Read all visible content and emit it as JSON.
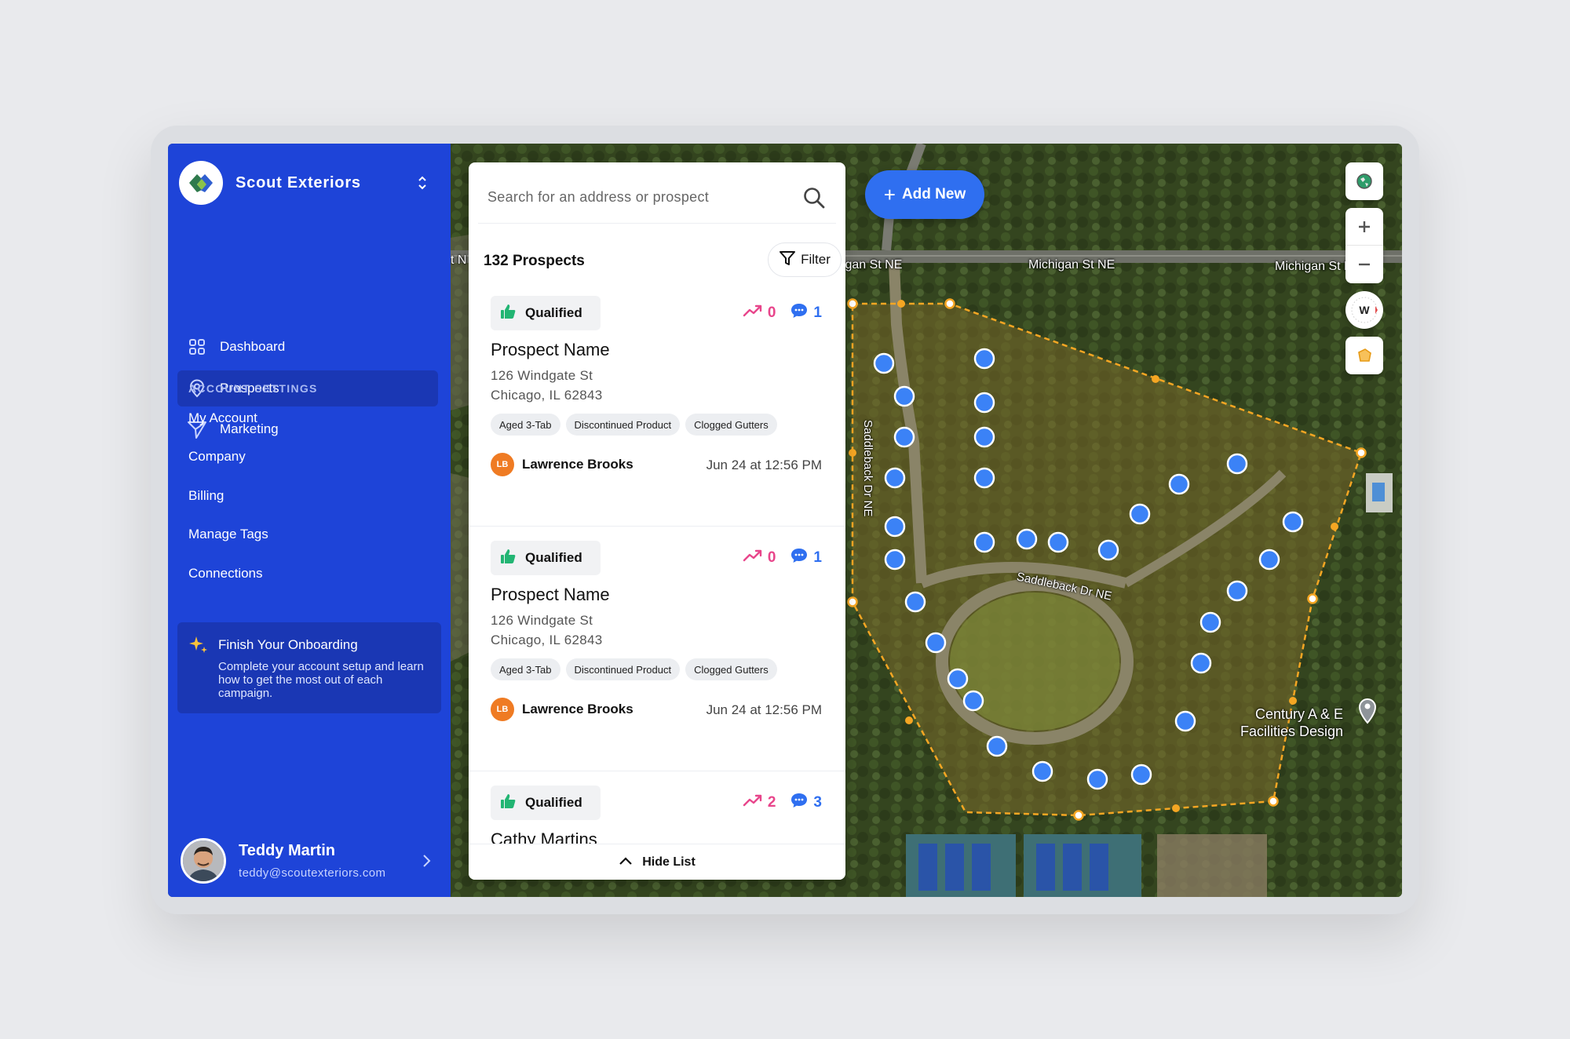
{
  "brand": {
    "name": "Scout Exteriors"
  },
  "nav": {
    "items": [
      {
        "label": "Dashboard",
        "icon": "grid-icon"
      },
      {
        "label": "Prospects",
        "icon": "location-pin-icon",
        "active": true
      },
      {
        "label": "Marketing",
        "icon": "send-icon"
      }
    ]
  },
  "settings": {
    "section_label": "ACCOUNT SETTINGS",
    "links": [
      "My Account",
      "Company",
      "Billing",
      "Manage Tags",
      "Connections"
    ]
  },
  "onboarding": {
    "title": "Finish Your Onboarding",
    "text": "Complete your account setup and learn how to get the most out of each campaign."
  },
  "user": {
    "name": "Teddy Martin",
    "email": "teddy@scoutexteriors.com"
  },
  "search": {
    "placeholder": "Search for an address or prospect"
  },
  "list": {
    "count_label": "132 Prospects",
    "filter_label": "Filter",
    "hide_label": "Hide List",
    "cards": [
      {
        "status": "Qualified",
        "views": "0",
        "messages": "1",
        "name": "Prospect Name",
        "street": "126 Windgate St",
        "city": "Chicago, IL 62843",
        "tags": [
          "Aged 3-Tab",
          "Discontinued Product",
          "Clogged Gutters"
        ],
        "owner_initials": "LB",
        "owner": "Lawrence Brooks",
        "time": "Jun 24 at 12:56 PM"
      },
      {
        "status": "Qualified",
        "views": "0",
        "messages": "1",
        "name": "Prospect Name",
        "street": "126 Windgate St",
        "city": "Chicago, IL 62843",
        "tags": [
          "Aged 3-Tab",
          "Discontinued Product",
          "Clogged Gutters"
        ],
        "owner_initials": "LB",
        "owner": "Lawrence Brooks",
        "time": "Jun 24 at 12:56 PM"
      },
      {
        "status": "Qualified",
        "views": "2",
        "messages": "3",
        "name": "Cathy Martins"
      }
    ]
  },
  "map": {
    "add_new_label": "Add New",
    "streets": {
      "michigan_1": "higan St NE",
      "michigan_2": "Michigan St NE",
      "michigan_3": "Michigan St N",
      "michigan_left": "t N",
      "saddleback_vertical": "Saddleback Dr NE",
      "saddleback_curve": "Saddleback Dr NE"
    },
    "poi": {
      "line1": "Century A & E",
      "line2": "Facilities Design"
    },
    "compass_label": "W",
    "colors": {
      "pin": "#3b82f6",
      "polygon": "#f5a623",
      "accent": "#1e44d8"
    }
  }
}
